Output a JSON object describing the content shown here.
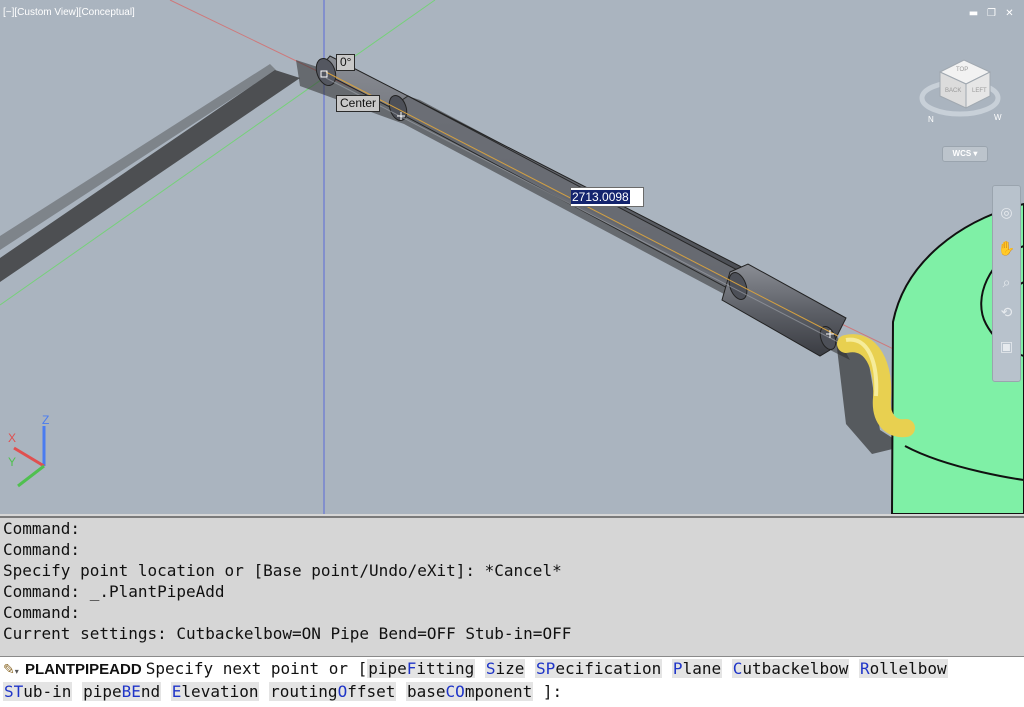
{
  "viewport": {
    "label": "[−][Custom View][Conceptual]",
    "window_controls": [
      "minimize-icon",
      "restore-icon",
      "close-icon"
    ],
    "tooltips": {
      "angle": "0°",
      "center": "Center"
    },
    "dynamic_input_value": "2713.0098",
    "viewcube": {
      "top": "TOP",
      "back": "BACK",
      "left": "LEFT",
      "compass_n": "N",
      "compass_w": "W"
    },
    "ucs_menu": "WCS ▾",
    "axis_labels": {
      "x": "X",
      "y": "Y",
      "z": "Z"
    }
  },
  "navigation_bar": {
    "icons": [
      "steering-wheel-icon",
      "pan-icon",
      "zoom-icon",
      "orbit-icon",
      "showmotion-icon"
    ]
  },
  "command_history": [
    "Command:",
    "Command:",
    "Specify point location or [Base point/Undo/eXit]: *Cancel*",
    "Command: _.PlantPipeAdd",
    "Command:",
    "Current settings: Cutbackelbow=ON Pipe Bend=OFF Stub-in=OFF"
  ],
  "command_line": {
    "command": "PLANTPIPEADD",
    "prompt": "Specify next point or [",
    "closing": "]:",
    "options": [
      {
        "pre": "pipe",
        "key": "F",
        "post": "itting"
      },
      {
        "pre": "",
        "key": "S",
        "post": "ize"
      },
      {
        "pre": "",
        "key": "SP",
        "post": "ecification"
      },
      {
        "pre": "",
        "key": "P",
        "post": "lane"
      },
      {
        "pre": "",
        "key": "C",
        "post": "utbackelbow"
      },
      {
        "pre": "",
        "key": "R",
        "post": "ollelbow"
      },
      {
        "pre": "",
        "key": "ST",
        "post": "ub-in"
      },
      {
        "pre": "pipe",
        "key": "BE",
        "post": "nd"
      },
      {
        "pre": "",
        "key": "E",
        "post": "levation"
      },
      {
        "pre": "routing",
        "key": "O",
        "post": "ffset"
      },
      {
        "pre": "base",
        "key": "CO",
        "post": "mponent"
      }
    ]
  },
  "colors": {
    "viewport_bg": "#aab4bf",
    "equipment": "#7ff0a6",
    "elbow": "#e8d050",
    "pipe": "#5e6168"
  }
}
